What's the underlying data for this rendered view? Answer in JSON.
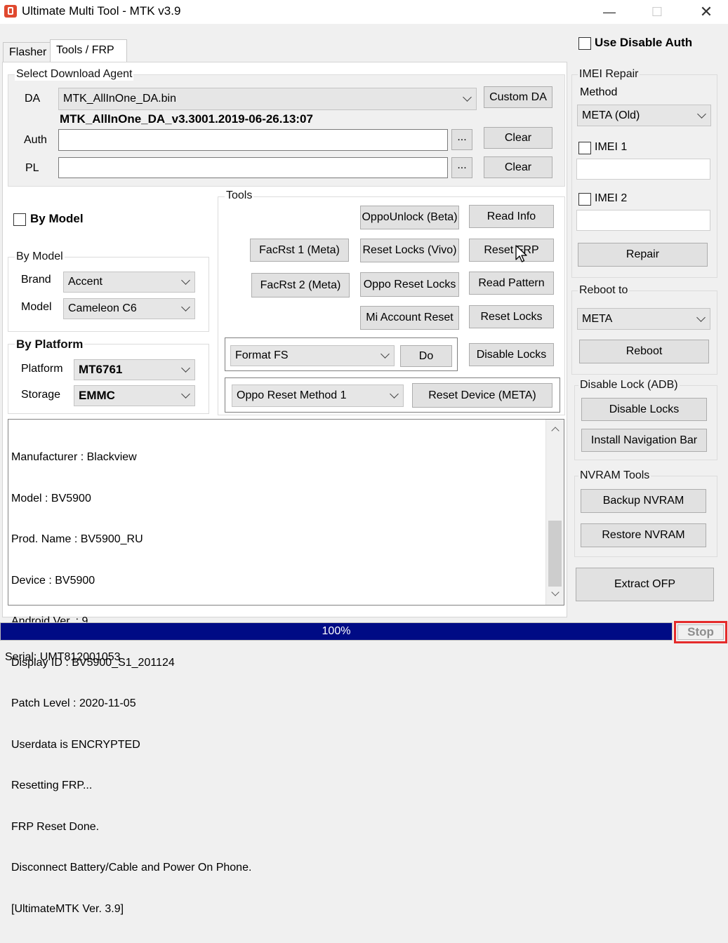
{
  "window": {
    "title": "Ultimate Multi Tool - MTK v3.9",
    "minimize": "—",
    "maximize": "☐",
    "close": "✕"
  },
  "tabs": [
    {
      "label": "Flasher",
      "active": false
    },
    {
      "label": "Tools / FRP",
      "active": true
    }
  ],
  "use_disable_auth": {
    "label": "Use Disable Auth",
    "checked": false
  },
  "download_agent": {
    "title": "Select Download Agent",
    "da_label": "DA",
    "da_value": "MTK_AllInOne_DA.bin",
    "da_version": "MTK_AllInOne_DA_v3.3001.2019-06-26.13:07",
    "custom_da": "Custom DA",
    "auth_label": "Auth",
    "auth_value": "",
    "pl_label": "PL",
    "pl_value": "",
    "browse": "...",
    "clear": "Clear"
  },
  "by_model_check": {
    "label": "By Model",
    "checked": false
  },
  "by_model": {
    "title": "By Model",
    "brand_label": "Brand",
    "brand_value": "Accent",
    "model_label": "Model",
    "model_value": "Cameleon C6"
  },
  "by_platform": {
    "title": "By Platform",
    "platform_label": "Platform",
    "platform_value": "MT6761",
    "storage_label": "Storage",
    "storage_value": "EMMC"
  },
  "tools": {
    "title": "Tools",
    "oppo_unlock": "OppoUnlock (Beta)",
    "read_info": "Read Info",
    "facrst1": "FacRst 1 (Meta)",
    "reset_locks_vivo": "Reset Locks (Vivo)",
    "reset_frp": "Reset FRP",
    "facrst2": "FacRst 2 (Meta)",
    "oppo_reset_locks": "Oppo Reset Locks",
    "read_pattern": "Read Pattern",
    "mi_account_reset": "Mi Account Reset",
    "reset_locks": "Reset Locks",
    "format_value": "Format FS",
    "do": "Do",
    "disable_locks": "Disable Locks",
    "oppo_method_value": "Oppo Reset Method 1",
    "reset_device_meta": "Reset Device (META)"
  },
  "log_lines": [
    "Manufacturer : Blackview",
    "Model : BV5900",
    "Prod. Name : BV5900_RU",
    "Device : BV5900",
    "Android Ver. : 9",
    "Display ID : BV5900_S1_201124",
    "Patch Level : 2020-11-05",
    "Userdata is ENCRYPTED",
    "Resetting FRP...",
    "FRP Reset Done.",
    "Disconnect Battery/Cable and Power On Phone.",
    "[UltimateMTK Ver. 3.9]"
  ],
  "imei_repair": {
    "title": "IMEI Repair",
    "method_label": "Method",
    "method_value": "META (Old)",
    "imei1_label": "IMEI 1",
    "imei1_value": "",
    "imei2_label": "IMEI 2",
    "imei2_value": "",
    "repair": "Repair"
  },
  "reboot": {
    "title": "Reboot to",
    "mode_value": "META",
    "button": "Reboot"
  },
  "disable_lock_adb": {
    "title": "Disable Lock (ADB)",
    "disable_locks": "Disable Locks",
    "install_nav": "Install Navigation Bar"
  },
  "nvram": {
    "title": "NVRAM Tools",
    "backup": "Backup NVRAM",
    "restore": "Restore NVRAM"
  },
  "extract_ofp": "Extract OFP",
  "progress": {
    "value": 100,
    "text": "100%"
  },
  "stop": "Stop",
  "serial": "Serial: UMT812001053",
  "colors": {
    "progress": "#000b85",
    "stop_highlight": "#e52b2b"
  }
}
